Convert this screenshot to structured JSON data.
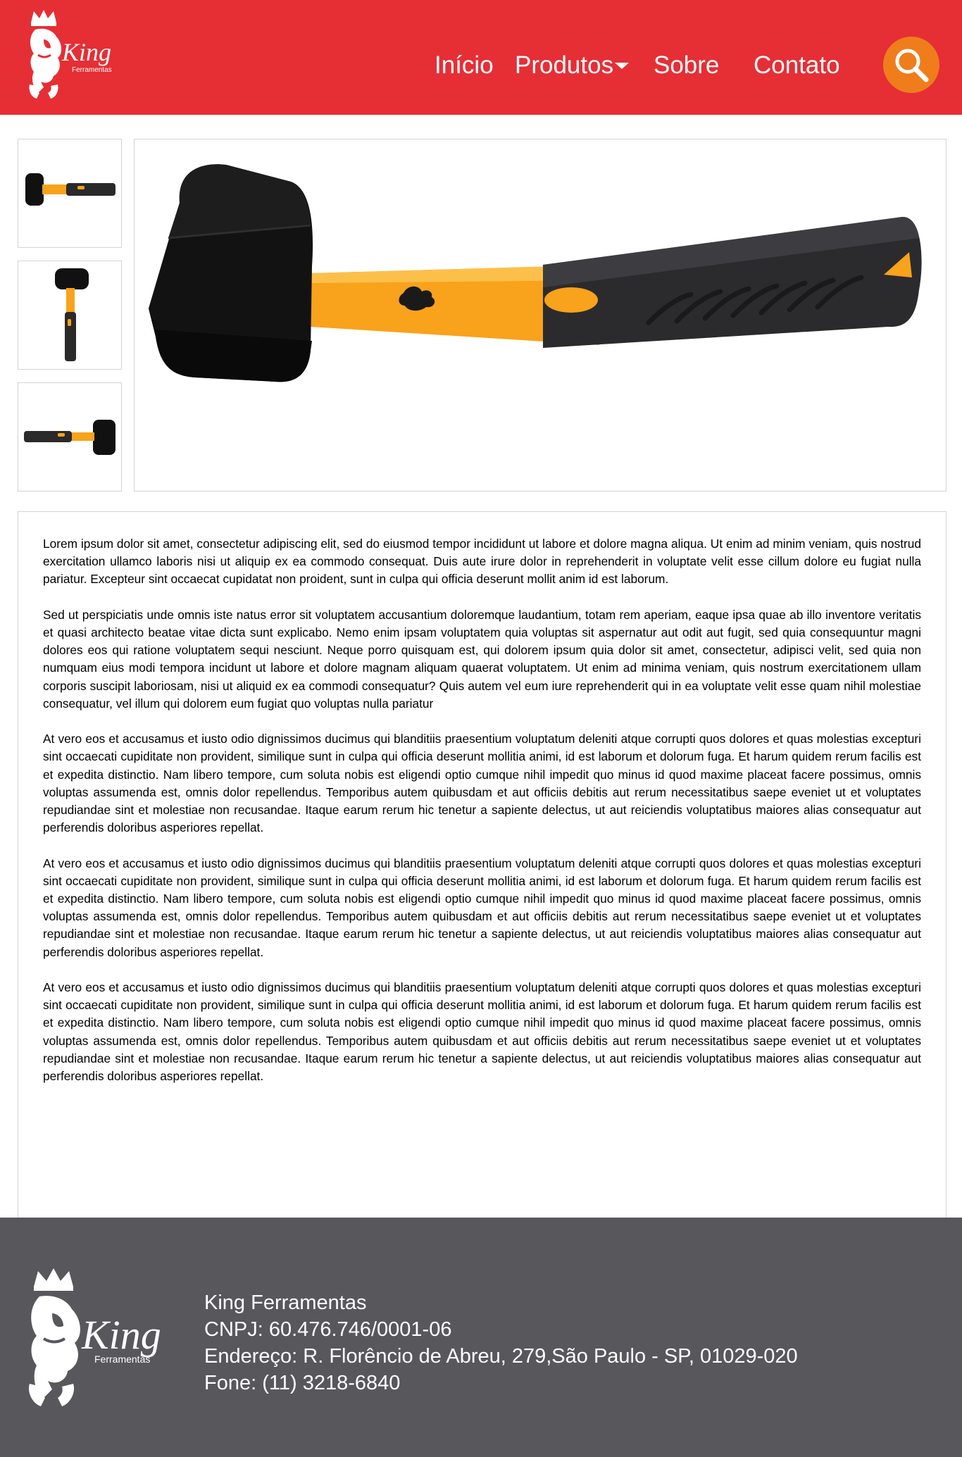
{
  "brand": {
    "name": "King",
    "subtitle": "Ferramentas",
    "primary_color": "#e62e35",
    "accent_color": "#f07d1b",
    "footer_color": "#58575c"
  },
  "nav": {
    "items": [
      {
        "label": "Início"
      },
      {
        "label": "Produtos"
      },
      {
        "label": "Sobre"
      },
      {
        "label": "Contato"
      }
    ],
    "search_icon": "search-icon"
  },
  "product": {
    "thumbnails": [
      "hammer-horizontal",
      "hammer-vertical",
      "hammer-reversed"
    ],
    "main_image": "rubber-mallet-orange-handle"
  },
  "description": {
    "paragraphs": [
      "Lorem ipsum dolor sit amet, consectetur adipiscing elit, sed do eiusmod tempor incididunt ut labore et dolore magna aliqua. Ut enim ad minim veniam, quis nostrud exercitation ullamco laboris nisi ut aliquip ex ea commodo consequat. Duis aute irure dolor in reprehenderit in voluptate velit esse cillum dolore eu fugiat nulla pariatur. Excepteur sint occaecat cupidatat non proident, sunt in culpa qui officia deserunt mollit anim id est laborum.",
      "Sed ut perspiciatis unde omnis iste natus error sit voluptatem accusantium doloremque laudantium, totam rem aperiam, eaque ipsa quae ab illo inventore veritatis et quasi architecto beatae vitae dicta sunt explicabo. Nemo enim ipsam voluptatem quia voluptas sit aspernatur aut odit aut fugit, sed quia consequuntur magni dolores eos qui ratione voluptatem sequi nesciunt. Neque porro quisquam est, qui dolorem ipsum quia dolor sit amet, consectetur, adipisci velit, sed quia non numquam eius modi tempora incidunt ut labore et dolore magnam aliquam quaerat voluptatem. Ut enim ad minima veniam, quis nostrum exercitationem ullam corporis suscipit laboriosam, nisi ut aliquid ex ea commodi consequatur? Quis autem vel eum iure reprehenderit qui in ea voluptate velit esse quam nihil molestiae consequatur, vel illum qui dolorem eum fugiat quo voluptas nulla pariatur",
      "At vero eos et accusamus et iusto odio dignissimos ducimus qui blanditiis praesentium voluptatum deleniti atque corrupti quos dolores et quas molestias excepturi sint occaecati cupiditate non provident, similique sunt in culpa qui officia deserunt mollitia animi, id est laborum et dolorum fuga. Et harum quidem rerum facilis est et expedita distinctio. Nam libero tempore, cum soluta nobis est eligendi optio cumque nihil impedit quo minus id quod maxime placeat facere possimus, omnis voluptas assumenda est, omnis dolor repellendus. Temporibus autem quibusdam et aut officiis debitis aut rerum necessitatibus saepe eveniet ut et voluptates repudiandae sint et molestiae non recusandae. Itaque earum rerum hic tenetur a sapiente delectus, ut aut reiciendis voluptatibus maiores alias consequatur aut perferendis doloribus asperiores repellat.",
      "At vero eos et accusamus et iusto odio dignissimos ducimus qui blanditiis praesentium voluptatum deleniti atque corrupti quos dolores et quas molestias excepturi sint occaecati cupiditate non provident, similique sunt in culpa qui officia deserunt mollitia animi, id est laborum et dolorum fuga. Et harum quidem rerum facilis est et expedita distinctio. Nam libero tempore, cum soluta nobis est eligendi optio cumque nihil impedit quo minus id quod maxime placeat facere possimus, omnis voluptas assumenda est, omnis dolor repellendus. Temporibus autem quibusdam et aut officiis debitis aut rerum necessitatibus saepe eveniet ut et voluptates repudiandae sint et molestiae non recusandae. Itaque earum rerum hic tenetur a sapiente delectus, ut aut reiciendis voluptatibus maiores alias consequatur aut perferendis doloribus asperiores repellat.",
      "At vero eos et accusamus et iusto odio dignissimos ducimus qui blanditiis praesentium voluptatum deleniti atque corrupti quos dolores et quas molestias excepturi sint occaecati cupiditate non provident, similique sunt in culpa qui officia deserunt mollitia animi, id est laborum et dolorum fuga. Et harum quidem rerum facilis est et expedita distinctio. Nam libero tempore, cum soluta nobis est eligendi optio cumque nihil impedit quo minus id quod maxime placeat facere possimus, omnis voluptas assumenda est, omnis dolor repellendus. Temporibus autem quibusdam et aut officiis debitis aut rerum necessitatibus saepe eveniet ut et voluptates repudiandae sint et molestiae non recusandae. Itaque earum rerum hic tenetur a sapiente delectus, ut aut reiciendis voluptatibus maiores alias consequatur aut perferendis doloribus asperiores repellat."
    ]
  },
  "footer": {
    "company": "King Ferramentas",
    "cnpj": "CNPJ: 60.476.746/0001-06",
    "address": "Endereço: R. Florêncio de Abreu, 279,São Paulo - SP, 01029-020",
    "phone": "Fone:  (11) 3218-6840"
  }
}
